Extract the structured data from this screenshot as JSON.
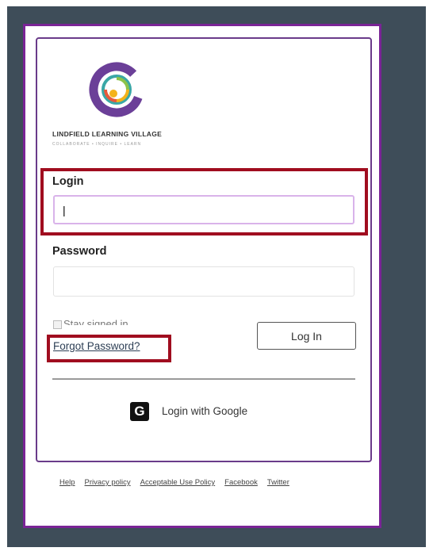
{
  "brand": {
    "name": "LINDFIELD LEARNING VILLAGE",
    "tagline": "COLLABORATE • INQUIRE • LEARN"
  },
  "login": {
    "label": "Login",
    "value": "|",
    "placeholder": ""
  },
  "password": {
    "label": "Password",
    "placeholder": ""
  },
  "stay_signed_in": {
    "label": "Stay signed in",
    "checked": false
  },
  "forgot_password": "Forgot Password?",
  "login_button": "Log In",
  "google_login": {
    "icon": "G",
    "label": "Login with Google"
  },
  "footer": {
    "links": [
      "Help",
      "Privacy policy",
      "Acceptable Use Policy",
      "Facebook",
      "Twitter"
    ]
  },
  "colors": {
    "backdrop": "#3e4d59",
    "frame": "#7a2496",
    "highlight": "#a00d1f"
  }
}
